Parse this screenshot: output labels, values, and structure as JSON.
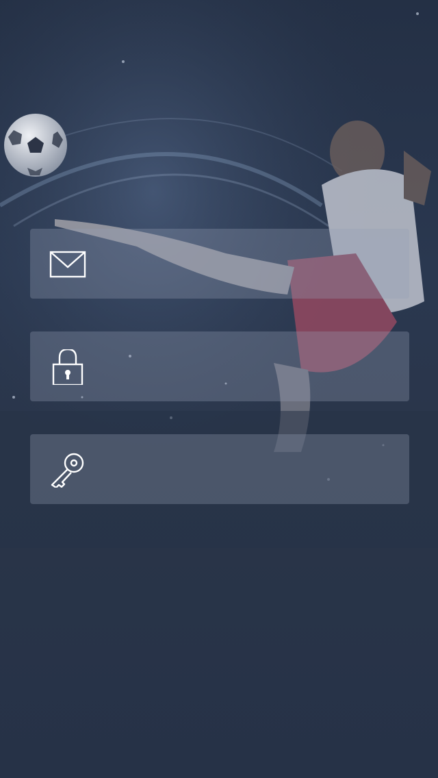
{
  "login_form": {
    "email_field": {
      "icon": "mail-icon",
      "value": "",
      "placeholder": ""
    },
    "password_field": {
      "icon": "lock-icon",
      "value": "",
      "placeholder": ""
    },
    "code_field": {
      "icon": "key-icon",
      "value": "",
      "placeholder": ""
    }
  },
  "background": {
    "subject": "soccer-player-kicking-ball",
    "overlay_color": "#263347",
    "field_fill": "#8f99ad",
    "icon_color": "#ffffff"
  }
}
